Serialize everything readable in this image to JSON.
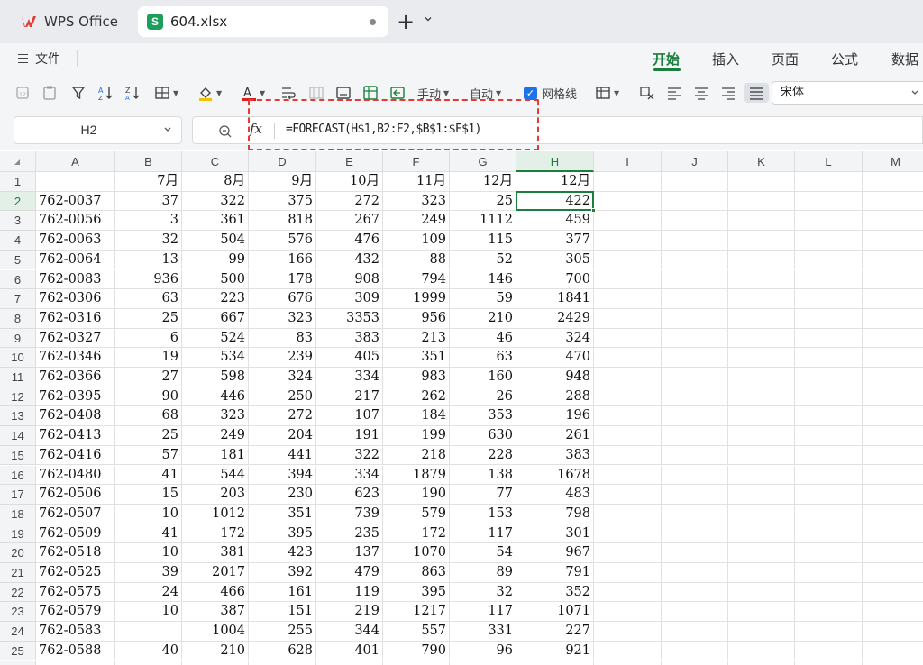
{
  "tabs": {
    "app_label": "WPS Office",
    "file_label": "604.xlsx",
    "file_icon_letter": "S",
    "new_tab_glyph": "+",
    "menu_glyph": "⌄"
  },
  "menu": {
    "file_label": "文件",
    "ribbon_tabs": [
      "开始",
      "插入",
      "页面",
      "公式",
      "数据"
    ],
    "active_tab": "开始"
  },
  "toolbar": {
    "manual_label": "手动",
    "auto_label": "自动",
    "gridlines_label": "网格线",
    "gridlines_checked": true,
    "font_name": "宋体",
    "accent_color": "#1a7f3c",
    "font_color_bar": "#e02020"
  },
  "formula_bar": {
    "name_box": "H2",
    "fx_label": "fx",
    "formula": "=FORECAST(H$1,B2:F2,$B$1:$F$1)"
  },
  "sheet": {
    "columns": [
      "A",
      "B",
      "C",
      "D",
      "E",
      "F",
      "G",
      "H",
      "I",
      "J",
      "K",
      "L",
      "M"
    ],
    "selected_cell": "H2",
    "rows": [
      [
        "",
        "7月",
        "8月",
        "9月",
        "10月",
        "11月",
        "12月",
        "12月"
      ],
      [
        "762-0037",
        "37",
        "322",
        "375",
        "272",
        "323",
        "25",
        "422"
      ],
      [
        "762-0056",
        "3",
        "361",
        "818",
        "267",
        "249",
        "1112",
        "459"
      ],
      [
        "762-0063",
        "32",
        "504",
        "576",
        "476",
        "109",
        "115",
        "377"
      ],
      [
        "762-0064",
        "13",
        "99",
        "166",
        "432",
        "88",
        "52",
        "305"
      ],
      [
        "762-0083",
        "936",
        "500",
        "178",
        "908",
        "794",
        "146",
        "700"
      ],
      [
        "762-0306",
        "63",
        "223",
        "676",
        "309",
        "1999",
        "59",
        "1841"
      ],
      [
        "762-0316",
        "25",
        "667",
        "323",
        "3353",
        "956",
        "210",
        "2429"
      ],
      [
        "762-0327",
        "6",
        "524",
        "83",
        "383",
        "213",
        "46",
        "324"
      ],
      [
        "762-0346",
        "19",
        "534",
        "239",
        "405",
        "351",
        "63",
        "470"
      ],
      [
        "762-0366",
        "27",
        "598",
        "324",
        "334",
        "983",
        "160",
        "948"
      ],
      [
        "762-0395",
        "90",
        "446",
        "250",
        "217",
        "262",
        "26",
        "288"
      ],
      [
        "762-0408",
        "68",
        "323",
        "272",
        "107",
        "184",
        "353",
        "196"
      ],
      [
        "762-0413",
        "25",
        "249",
        "204",
        "191",
        "199",
        "630",
        "261"
      ],
      [
        "762-0416",
        "57",
        "181",
        "441",
        "322",
        "218",
        "228",
        "383"
      ],
      [
        "762-0480",
        "41",
        "544",
        "394",
        "334",
        "1879",
        "138",
        "1678"
      ],
      [
        "762-0506",
        "15",
        "203",
        "230",
        "623",
        "190",
        "77",
        "483"
      ],
      [
        "762-0507",
        "10",
        "1012",
        "351",
        "739",
        "579",
        "153",
        "798"
      ],
      [
        "762-0509",
        "41",
        "172",
        "395",
        "235",
        "172",
        "117",
        "301"
      ],
      [
        "762-0518",
        "10",
        "381",
        "423",
        "137",
        "1070",
        "54",
        "967"
      ],
      [
        "762-0525",
        "39",
        "2017",
        "392",
        "479",
        "863",
        "89",
        "791"
      ],
      [
        "762-0575",
        "24",
        "466",
        "161",
        "119",
        "395",
        "32",
        "352"
      ],
      [
        "762-0579",
        "10",
        "387",
        "151",
        "219",
        "1217",
        "117",
        "1071"
      ],
      [
        "762-0583",
        "",
        "1004",
        "255",
        "344",
        "557",
        "331",
        "227"
      ],
      [
        "762-0588",
        "40",
        "210",
        "628",
        "401",
        "790",
        "96",
        "921"
      ]
    ]
  }
}
